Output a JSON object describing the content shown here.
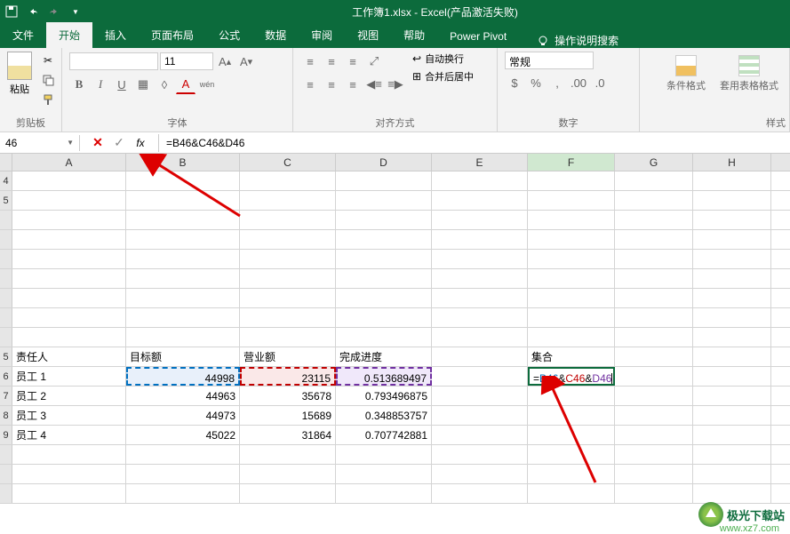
{
  "title": "工作簿1.xlsx - Excel(产品激活失败)",
  "tabs": {
    "file": "文件",
    "home": "开始",
    "insert": "插入",
    "page_layout": "页面布局",
    "formulas": "公式",
    "data": "数据",
    "review": "审阅",
    "view": "视图",
    "help": "帮助",
    "power_pivot": "Power Pivot",
    "search": "操作说明搜索"
  },
  "ribbon": {
    "clipboard": {
      "paste": "粘贴",
      "label": "剪贴板"
    },
    "font": {
      "family": "",
      "size": "11",
      "bold": "B",
      "italic": "I",
      "underline": "U",
      "ruby": "wén",
      "label": "字体"
    },
    "align": {
      "wrap": "自动换行",
      "merge": "合并后居中",
      "label": "对齐方式"
    },
    "number": {
      "format": "常规",
      "label": "数字"
    },
    "styles": {
      "conditional": "条件格式",
      "table": "套用表格格式",
      "label": "样式"
    }
  },
  "formula_bar": {
    "name_box": "46",
    "formula": "=B46&C46&D46"
  },
  "columns": [
    "A",
    "B",
    "C",
    "D",
    "E",
    "F",
    "G",
    "H"
  ],
  "row_labels": [
    "4",
    "5",
    "",
    "",
    "",
    "",
    "",
    "",
    "",
    "",
    "",
    "",
    "",
    "",
    "",
    "",
    "",
    "5",
    "6",
    "7",
    "8",
    "9"
  ],
  "grid": {
    "headers_row": {
      "A": "责任人",
      "B": "目标额",
      "C": "营业额",
      "D": "完成进度",
      "F": "集合"
    },
    "data": [
      {
        "A": "员工 1",
        "B": "44998",
        "C": "23115",
        "D": "0.513689497"
      },
      {
        "A": "员工 2",
        "B": "44963",
        "C": "35678",
        "D": "0.793496875"
      },
      {
        "A": "员工 3",
        "B": "44973",
        "C": "15689",
        "D": "0.348853757"
      },
      {
        "A": "员工 4",
        "B": "45022",
        "C": "31864",
        "D": "0.707742881"
      }
    ],
    "edit_formula": {
      "eq": "=",
      "r1": "B46",
      "amp": "&",
      "r2": "C46",
      "r3": "D46"
    }
  },
  "watermark": {
    "text": "极光下载站",
    "url": "www.xz7.com"
  }
}
